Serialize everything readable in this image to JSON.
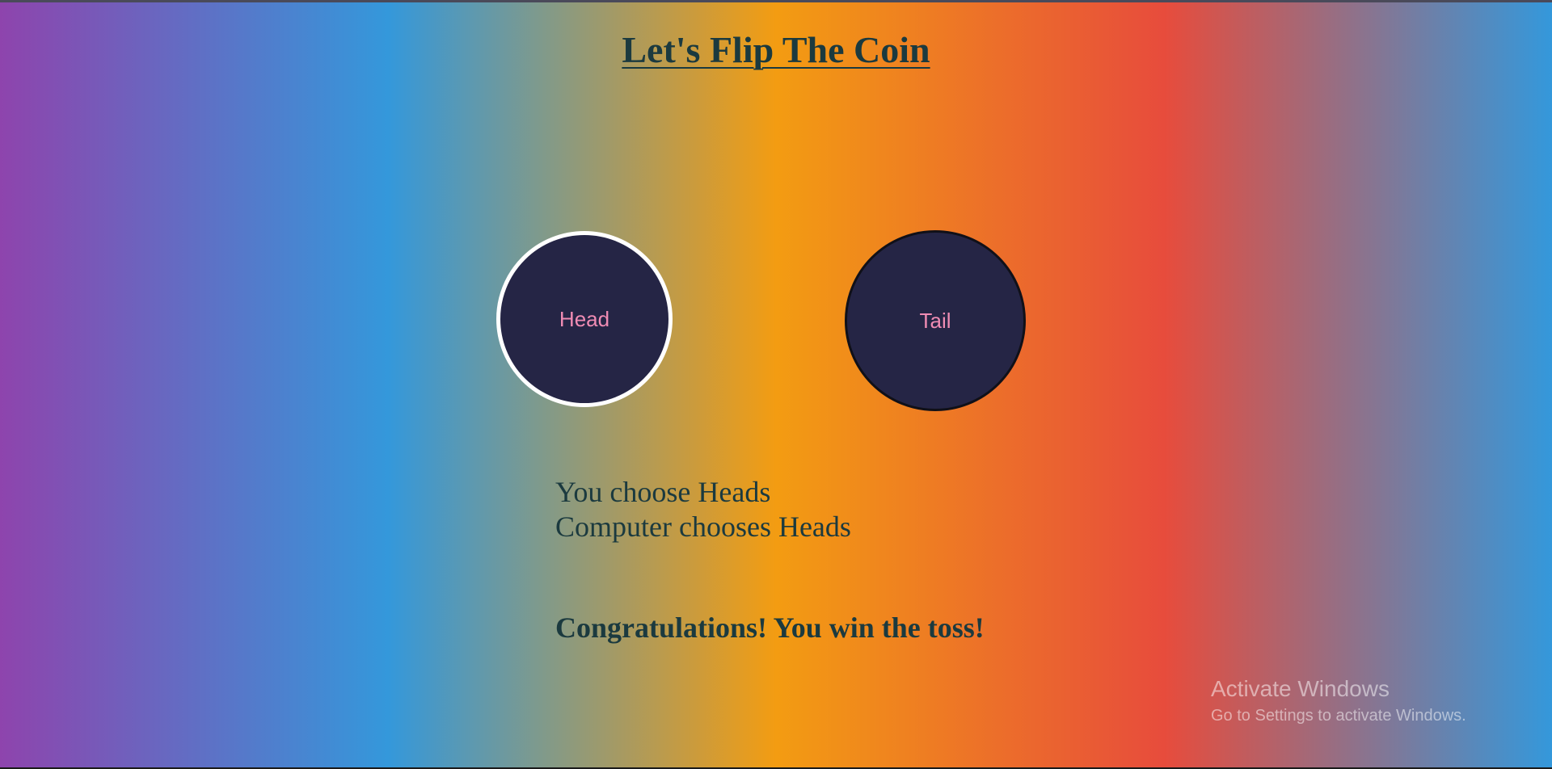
{
  "page": {
    "title": "Let's Flip The Coin"
  },
  "coins": {
    "head": {
      "label": "Head",
      "selected": true
    },
    "tail": {
      "label": "Tail",
      "selected": false
    }
  },
  "result": {
    "user_choice": "You choose Heads",
    "computer_choice": "Computer chooses Heads",
    "outcome": "Congratulations! You win the toss!"
  },
  "watermark": {
    "title": "Activate Windows",
    "subtitle": "Go to Settings to activate Windows."
  },
  "colors": {
    "title_text": "#1b3a3f",
    "coin_fill": "#252545",
    "coin_label": "#f08cb4",
    "selected_border": "#ffffff",
    "gradient": [
      "#8e44ad",
      "#3498db",
      "#f39c12",
      "#e74c3c",
      "#3498db"
    ]
  }
}
